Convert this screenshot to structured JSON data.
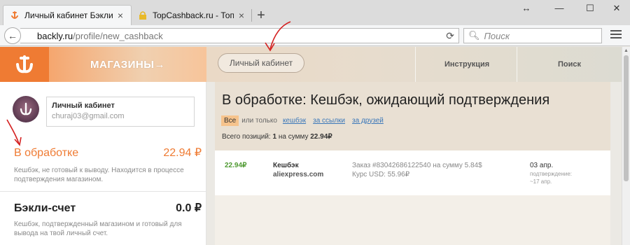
{
  "browser": {
    "tabs": [
      {
        "title": "Личный кабинет Бэкли",
        "close": "×",
        "active": true
      },
      {
        "title": "TopCashback.ru - Топ лу",
        "close": "×",
        "active": false
      }
    ],
    "new_tab": "+",
    "window_controls": {
      "resize": "↔",
      "minimize": "—",
      "maximize": "☐",
      "close": "✕"
    },
    "url_domain": "backly.ru",
    "url_path": "/profile/new_cashback",
    "search_placeholder": "Поиск"
  },
  "site": {
    "stores_label": "МАГАЗИНЫ→",
    "cabinet_label": "Личный кабинет",
    "nav": {
      "instructions": "Инструкция",
      "search": "Поиск"
    }
  },
  "sidebar": {
    "profile_title": "Личный кабинет",
    "email": "churaj03@gmail.com",
    "pending": {
      "label": "В обработке",
      "amount": "22.94 ₽",
      "desc": "Кешбэк, не готовый к выводу. Находится в процессе подтверждения магазином."
    },
    "account": {
      "label": "Бэкли-счет",
      "amount": "0.0 ₽",
      "desc": "Кешбэк, подтвержденный магазином и готовый для вывода на твой личный счет."
    }
  },
  "main": {
    "title": "В обработке: Кешбэк, ожидающий подтверждения",
    "filters": {
      "all": "Все",
      "or_only": "или только",
      "cashback": "кешбэк",
      "by_link": "за ссылки",
      "for_friends": "за друзей"
    },
    "totals": {
      "prefix": "Всего позиций:",
      "count": "1",
      "middle": "на сумму",
      "sum": "22.94₽"
    },
    "rows": [
      {
        "amount": "22.94₽",
        "type": "Кешбэк",
        "store": "aliexpress.com",
        "order": "Заказ #83042686122540 на сумму 5.84$",
        "rate": "Курс USD: 55.96₽",
        "date": "03 апр.",
        "confirm_label": "подтверждение:",
        "confirm_date": "~17 апр."
      }
    ]
  },
  "colors": {
    "brand_orange": "#ef7b33",
    "amount_green": "#4f9a32",
    "link_blue": "#3a77b9",
    "annotation_red": "#d42020"
  }
}
